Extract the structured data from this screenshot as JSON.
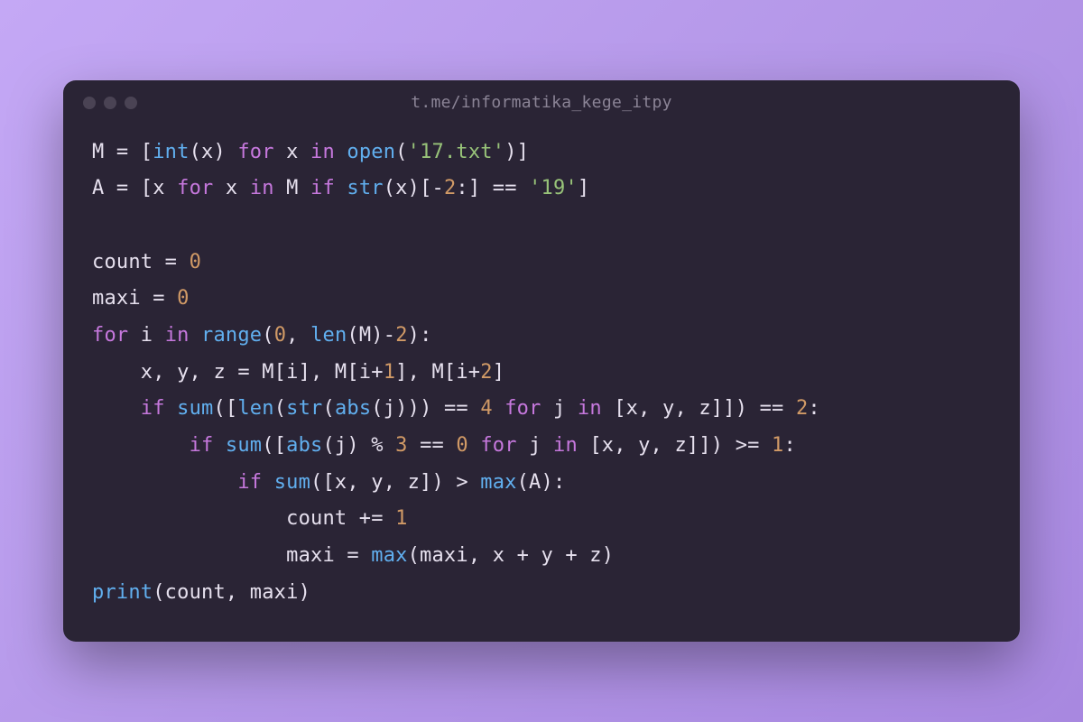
{
  "title": "t.me/informatika_kege_itpy",
  "code": {
    "lines": [
      [
        {
          "t": "M ",
          "c": "var"
        },
        {
          "t": "= ",
          "c": "op"
        },
        {
          "t": "[",
          "c": "punc"
        },
        {
          "t": "int",
          "c": "call"
        },
        {
          "t": "(x) ",
          "c": "punc"
        },
        {
          "t": "for",
          "c": "kw"
        },
        {
          "t": " x ",
          "c": "var"
        },
        {
          "t": "in",
          "c": "kw"
        },
        {
          "t": " ",
          "c": "var"
        },
        {
          "t": "open",
          "c": "call"
        },
        {
          "t": "(",
          "c": "punc"
        },
        {
          "t": "'17.txt'",
          "c": "str"
        },
        {
          "t": ")]",
          "c": "punc"
        }
      ],
      [
        {
          "t": "A ",
          "c": "var"
        },
        {
          "t": "= ",
          "c": "op"
        },
        {
          "t": "[x ",
          "c": "punc"
        },
        {
          "t": "for",
          "c": "kw"
        },
        {
          "t": " x ",
          "c": "var"
        },
        {
          "t": "in",
          "c": "kw"
        },
        {
          "t": " M ",
          "c": "var"
        },
        {
          "t": "if",
          "c": "kw"
        },
        {
          "t": " ",
          "c": "var"
        },
        {
          "t": "str",
          "c": "call"
        },
        {
          "t": "(x)[-",
          "c": "punc"
        },
        {
          "t": "2",
          "c": "num"
        },
        {
          "t": ":] ",
          "c": "punc"
        },
        {
          "t": "== ",
          "c": "op"
        },
        {
          "t": "'19'",
          "c": "str"
        },
        {
          "t": "]",
          "c": "punc"
        }
      ],
      [
        {
          "t": "",
          "c": "var"
        }
      ],
      [
        {
          "t": "count ",
          "c": "var"
        },
        {
          "t": "= ",
          "c": "op"
        },
        {
          "t": "0",
          "c": "num"
        }
      ],
      [
        {
          "t": "maxi ",
          "c": "var"
        },
        {
          "t": "= ",
          "c": "op"
        },
        {
          "t": "0",
          "c": "num"
        }
      ],
      [
        {
          "t": "for",
          "c": "kw"
        },
        {
          "t": " i ",
          "c": "var"
        },
        {
          "t": "in",
          "c": "kw"
        },
        {
          "t": " ",
          "c": "var"
        },
        {
          "t": "range",
          "c": "call"
        },
        {
          "t": "(",
          "c": "punc"
        },
        {
          "t": "0",
          "c": "num"
        },
        {
          "t": ", ",
          "c": "punc"
        },
        {
          "t": "len",
          "c": "call"
        },
        {
          "t": "(M)-",
          "c": "punc"
        },
        {
          "t": "2",
          "c": "num"
        },
        {
          "t": "):",
          "c": "punc"
        }
      ],
      [
        {
          "t": "    x, y, z ",
          "c": "var"
        },
        {
          "t": "= ",
          "c": "op"
        },
        {
          "t": "M[i], M[i+",
          "c": "var"
        },
        {
          "t": "1",
          "c": "num"
        },
        {
          "t": "], M[i+",
          "c": "var"
        },
        {
          "t": "2",
          "c": "num"
        },
        {
          "t": "]",
          "c": "punc"
        }
      ],
      [
        {
          "t": "    ",
          "c": "var"
        },
        {
          "t": "if",
          "c": "kw"
        },
        {
          "t": " ",
          "c": "var"
        },
        {
          "t": "sum",
          "c": "call"
        },
        {
          "t": "([",
          "c": "punc"
        },
        {
          "t": "len",
          "c": "call"
        },
        {
          "t": "(",
          "c": "punc"
        },
        {
          "t": "str",
          "c": "call"
        },
        {
          "t": "(",
          "c": "punc"
        },
        {
          "t": "abs",
          "c": "call"
        },
        {
          "t": "(j))) ",
          "c": "punc"
        },
        {
          "t": "== ",
          "c": "op"
        },
        {
          "t": "4",
          "c": "num"
        },
        {
          "t": " ",
          "c": "var"
        },
        {
          "t": "for",
          "c": "kw"
        },
        {
          "t": " j ",
          "c": "var"
        },
        {
          "t": "in",
          "c": "kw"
        },
        {
          "t": " [x, y, z]]) ",
          "c": "punc"
        },
        {
          "t": "== ",
          "c": "op"
        },
        {
          "t": "2",
          "c": "num"
        },
        {
          "t": ":",
          "c": "punc"
        }
      ],
      [
        {
          "t": "        ",
          "c": "var"
        },
        {
          "t": "if",
          "c": "kw"
        },
        {
          "t": " ",
          "c": "var"
        },
        {
          "t": "sum",
          "c": "call"
        },
        {
          "t": "([",
          "c": "punc"
        },
        {
          "t": "abs",
          "c": "call"
        },
        {
          "t": "(j) ",
          "c": "punc"
        },
        {
          "t": "% ",
          "c": "op"
        },
        {
          "t": "3",
          "c": "num"
        },
        {
          "t": " ",
          "c": "var"
        },
        {
          "t": "== ",
          "c": "op"
        },
        {
          "t": "0",
          "c": "num"
        },
        {
          "t": " ",
          "c": "var"
        },
        {
          "t": "for",
          "c": "kw"
        },
        {
          "t": " j ",
          "c": "var"
        },
        {
          "t": "in",
          "c": "kw"
        },
        {
          "t": " [x, y, z]]) ",
          "c": "punc"
        },
        {
          "t": ">= ",
          "c": "op"
        },
        {
          "t": "1",
          "c": "num"
        },
        {
          "t": ":",
          "c": "punc"
        }
      ],
      [
        {
          "t": "            ",
          "c": "var"
        },
        {
          "t": "if",
          "c": "kw"
        },
        {
          "t": " ",
          "c": "var"
        },
        {
          "t": "sum",
          "c": "call"
        },
        {
          "t": "([x, y, z]) ",
          "c": "punc"
        },
        {
          "t": "> ",
          "c": "op"
        },
        {
          "t": "max",
          "c": "call"
        },
        {
          "t": "(A):",
          "c": "punc"
        }
      ],
      [
        {
          "t": "                count ",
          "c": "var"
        },
        {
          "t": "+= ",
          "c": "op"
        },
        {
          "t": "1",
          "c": "num"
        }
      ],
      [
        {
          "t": "                maxi ",
          "c": "var"
        },
        {
          "t": "= ",
          "c": "op"
        },
        {
          "t": "max",
          "c": "call"
        },
        {
          "t": "(maxi, x ",
          "c": "punc"
        },
        {
          "t": "+ ",
          "c": "op"
        },
        {
          "t": "y ",
          "c": "var"
        },
        {
          "t": "+ ",
          "c": "op"
        },
        {
          "t": "z)",
          "c": "punc"
        }
      ],
      [
        {
          "t": "print",
          "c": "call"
        },
        {
          "t": "(count, maxi)",
          "c": "punc"
        }
      ]
    ]
  }
}
